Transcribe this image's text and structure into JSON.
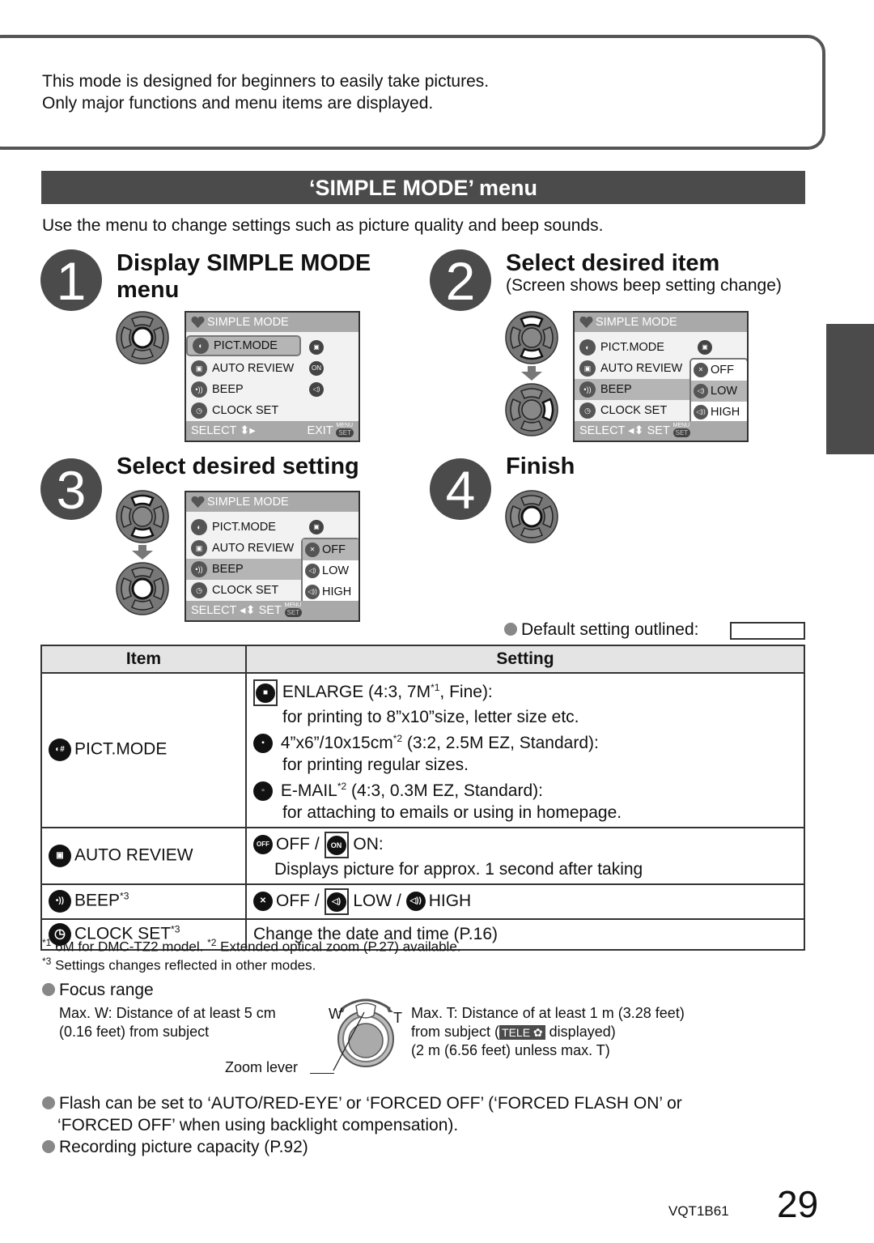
{
  "intro": {
    "line1": "This mode is designed for beginners to easily take pictures.",
    "line2": "Only major functions and menu items are displayed."
  },
  "section": {
    "title": "‘SIMPLE MODE’ menu",
    "lead": "Use the menu to change settings such as picture quality and beep sounds."
  },
  "steps": [
    {
      "number": "1",
      "title_line1": "Display SIMPLE MODE",
      "title_line2": "menu"
    },
    {
      "number": "2",
      "title_line1": "Select desired item",
      "subtitle": "(Screen shows beep setting change)"
    },
    {
      "number": "3",
      "title_line1": "Select desired setting"
    },
    {
      "number": "4",
      "title_line1": "Finish"
    }
  ],
  "lcd": {
    "header": "SIMPLE MODE",
    "items": [
      "PICT.MODE",
      "AUTO REVIEW",
      "BEEP",
      "CLOCK SET"
    ],
    "item_icons": [
      "pict",
      "rev",
      "·))",
      "◷"
    ],
    "values_step1": [
      "▣",
      "ON",
      "◁)"
    ],
    "options": [
      "OFF",
      "LOW",
      "HIGH"
    ],
    "footer_step1_left": "SELECT ⬍▸",
    "footer_step1_right": "EXIT",
    "footer_select_set": "SELECT ◂⬍ SET",
    "chip_set": "SET",
    "chip_menu": "MENU"
  },
  "default_note": "Default setting outlined:",
  "table": {
    "headers": [
      "Item",
      "Setting"
    ],
    "rows": [
      {
        "item": "PICT.MODE",
        "item_icon": "pict-mode-icon",
        "lines": [
          {
            "icon": "enlarge",
            "text": "ENLARGE (4:3, 7M",
            "sup": "*1",
            "after": ", Fine):"
          },
          {
            "text": "for printing to 8”x10”size, letter size etc."
          },
          {
            "icon": "4x6",
            "text": " 4”x6”/10x15cm",
            "sup": "*2",
            "after": " (3:2, 2.5M EZ, Standard):"
          },
          {
            "text": "for printing regular sizes."
          },
          {
            "icon": "email",
            "text": " E-MAIL",
            "sup": "*2",
            "after": " (4:3, 0.3M EZ, Standard):"
          },
          {
            "text": "for attaching to emails or using in homepage."
          }
        ]
      },
      {
        "item": "AUTO REVIEW",
        "off_icon": "OFF",
        "on_icon": "ON",
        "line1_off": "OFF /",
        "line1_on": "ON:",
        "line2": "Displays picture for approx. 1 second after taking"
      },
      {
        "item": "BEEP",
        "sup": "*3",
        "off": "OFF /",
        "low": "LOW /",
        "high": "HIGH"
      },
      {
        "item": "CLOCK SET",
        "sup": "*3",
        "setting": "Change the date and time (P.16)"
      }
    ]
  },
  "footnotes": {
    "n1_mark": "*1",
    "n1": "6M for DMC-TZ2 model.",
    "n2_mark": "*2",
    "n2": "Extended optical zoom (P.27) available.",
    "n3_mark": "*3",
    "n3": "Settings changes reflected in other modes."
  },
  "focus": {
    "title": "Focus range",
    "w_line1": "Max. W: Distance of at least 5 cm",
    "w_line2": "(0.16 feet) from subject",
    "t_line1": "Max. T: Distance of at least 1 m (3.28 feet)",
    "t_line2a": "from subject (",
    "t_tele": "TELE",
    "t_line2b": " displayed)",
    "t_line3": "(2 m (6.56 feet) unless max. T)",
    "w_label": "W",
    "t_label": "T",
    "zoom_lever": "Zoom lever"
  },
  "notes": {
    "flash_line1": "Flash can be set to ‘AUTO/RED-EYE’ or ‘FORCED OFF’ (‘FORCED FLASH ON’ or",
    "flash_line2": "‘FORCED OFF’ when using backlight compensation).",
    "capacity": "Recording picture capacity (P.92)"
  },
  "footer": {
    "code": "VQT1B61",
    "page": "29"
  }
}
